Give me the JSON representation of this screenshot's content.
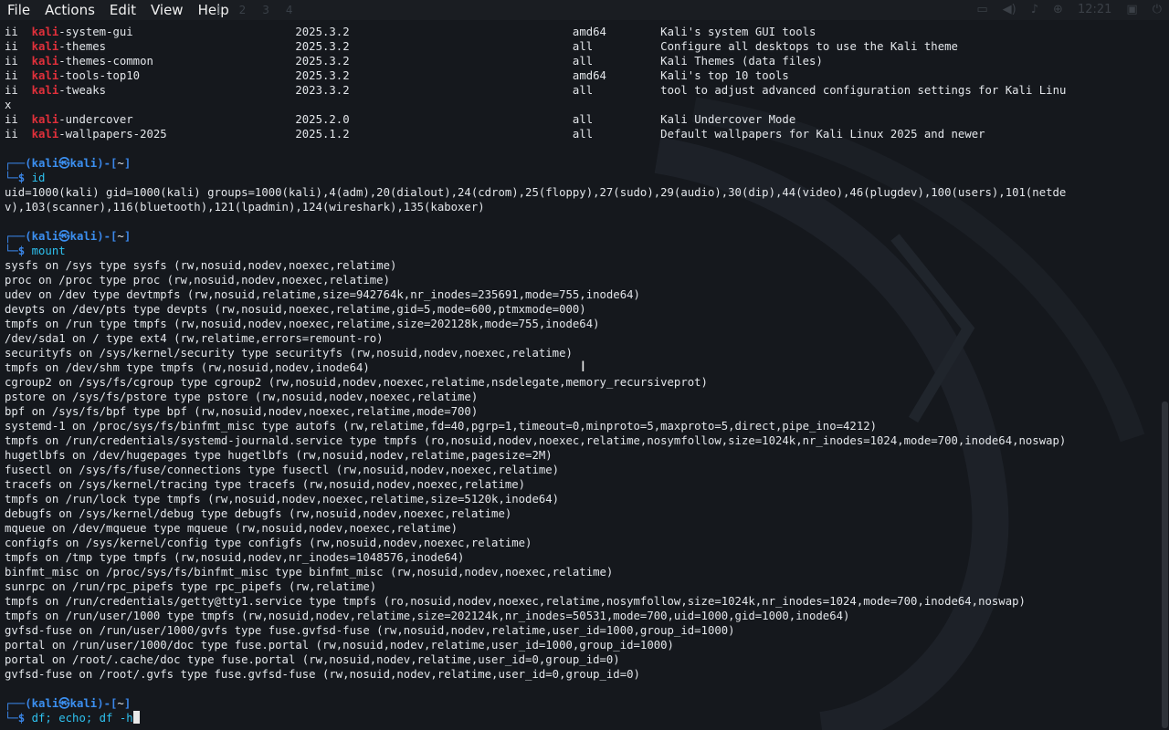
{
  "menu": [
    "File",
    "Actions",
    "Edit",
    "View",
    "Help"
  ],
  "tray": {
    "clock": "12:21"
  },
  "workspaces": [
    "1",
    "2",
    "3",
    "4"
  ],
  "packages": [
    {
      "prefix": "ii",
      "name_hl": "kali",
      "name_rest": "-system-gui",
      "version": "2025.3.2",
      "arch": "amd64",
      "desc": "Kali's system GUI tools"
    },
    {
      "prefix": "ii",
      "name_hl": "kali",
      "name_rest": "-themes",
      "version": "2025.3.2",
      "arch": "all",
      "desc": "Configure all desktops to use the Kali theme"
    },
    {
      "prefix": "ii",
      "name_hl": "kali",
      "name_rest": "-themes-common",
      "version": "2025.3.2",
      "arch": "all",
      "desc": "Kali Themes (data files)"
    },
    {
      "prefix": "ii",
      "name_hl": "kali",
      "name_rest": "-tools-top10",
      "version": "2025.3.2",
      "arch": "amd64",
      "desc": "Kali's top 10 tools"
    },
    {
      "prefix": "ii",
      "name_hl": "kali",
      "name_rest": "-tweaks",
      "version": "2023.3.2",
      "arch": "all",
      "desc": "tool to adjust advanced configuration settings for Kali Linu"
    },
    {
      "prefix": "ii",
      "name_hl": "kali",
      "name_rest": "-undercover",
      "version": "2025.2.0",
      "arch": "all",
      "desc": "Kali Undercover Mode"
    },
    {
      "prefix": "ii",
      "name_hl": "kali",
      "name_rest": "-wallpapers-2025",
      "version": "2025.1.2",
      "arch": "all",
      "desc": "Default wallpapers for Kali Linux 2025 and newer"
    }
  ],
  "wrap_x": "x",
  "prompt": {
    "user": "kali",
    "host": "kali",
    "dir": "~"
  },
  "id_cmd": "id",
  "id_output": [
    "uid=1000(kali) gid=1000(kali) groups=1000(kali),4(adm),20(dialout),24(cdrom),25(floppy),27(sudo),29(audio),30(dip),44(video),46(plugdev),100(users),101(netde",
    "v),103(scanner),116(bluetooth),121(lpadmin),124(wireshark),135(kaboxer)"
  ],
  "mount_cmd": "mount",
  "mount_output": [
    "sysfs on /sys type sysfs (rw,nosuid,nodev,noexec,relatime)",
    "proc on /proc type proc (rw,nosuid,nodev,noexec,relatime)",
    "udev on /dev type devtmpfs (rw,nosuid,relatime,size=942764k,nr_inodes=235691,mode=755,inode64)",
    "devpts on /dev/pts type devpts (rw,nosuid,noexec,relatime,gid=5,mode=600,ptmxmode=000)",
    "tmpfs on /run type tmpfs (rw,nosuid,nodev,noexec,relatime,size=202128k,mode=755,inode64)",
    "/dev/sda1 on / type ext4 (rw,relatime,errors=remount-ro)",
    "securityfs on /sys/kernel/security type securityfs (rw,nosuid,nodev,noexec,relatime)",
    "tmpfs on /dev/shm type tmpfs (rw,nosuid,nodev,inode64)",
    "cgroup2 on /sys/fs/cgroup type cgroup2 (rw,nosuid,nodev,noexec,relatime,nsdelegate,memory_recursiveprot)",
    "pstore on /sys/fs/pstore type pstore (rw,nosuid,nodev,noexec,relatime)",
    "bpf on /sys/fs/bpf type bpf (rw,nosuid,nodev,noexec,relatime,mode=700)",
    "systemd-1 on /proc/sys/fs/binfmt_misc type autofs (rw,relatime,fd=40,pgrp=1,timeout=0,minproto=5,maxproto=5,direct,pipe_ino=4212)",
    "tmpfs on /run/credentials/systemd-journald.service type tmpfs (ro,nosuid,nodev,noexec,relatime,nosymfollow,size=1024k,nr_inodes=1024,mode=700,inode64,noswap)",
    "hugetlbfs on /dev/hugepages type hugetlbfs (rw,nosuid,nodev,relatime,pagesize=2M)",
    "fusectl on /sys/fs/fuse/connections type fusectl (rw,nosuid,nodev,noexec,relatime)",
    "tracefs on /sys/kernel/tracing type tracefs (rw,nosuid,nodev,noexec,relatime)",
    "tmpfs on /run/lock type tmpfs (rw,nosuid,nodev,noexec,relatime,size=5120k,inode64)",
    "debugfs on /sys/kernel/debug type debugfs (rw,nosuid,nodev,noexec,relatime)",
    "mqueue on /dev/mqueue type mqueue (rw,nosuid,nodev,noexec,relatime)",
    "configfs on /sys/kernel/config type configfs (rw,nosuid,nodev,noexec,relatime)",
    "tmpfs on /tmp type tmpfs (rw,nosuid,nodev,nr_inodes=1048576,inode64)",
    "binfmt_misc on /proc/sys/fs/binfmt_misc type binfmt_misc (rw,nosuid,nodev,noexec,relatime)",
    "sunrpc on /run/rpc_pipefs type rpc_pipefs (rw,relatime)",
    "tmpfs on /run/credentials/getty@tty1.service type tmpfs (ro,nosuid,nodev,noexec,relatime,nosymfollow,size=1024k,nr_inodes=1024,mode=700,inode64,noswap)",
    "tmpfs on /run/user/1000 type tmpfs (rw,nosuid,nodev,relatime,size=202124k,nr_inodes=50531,mode=700,uid=1000,gid=1000,inode64)",
    "gvfsd-fuse on /run/user/1000/gvfs type fuse.gvfsd-fuse (rw,nosuid,nodev,relatime,user_id=1000,group_id=1000)",
    "portal on /run/user/1000/doc type fuse.portal (rw,nosuid,nodev,relatime,user_id=1000,group_id=1000)",
    "portal on /root/.cache/doc type fuse.portal (rw,nosuid,nodev,relatime,user_id=0,group_id=0)",
    "gvfsd-fuse on /root/.gvfs type fuse.gvfsd-fuse (rw,nosuid,nodev,relatime,user_id=0,group_id=0)"
  ],
  "current_cmd": "df; echo; df -h",
  "colors": {
    "bg": "#15181d",
    "accent_blue": "#3b8ff0",
    "accent_red": "#e0303b",
    "cmd_cyan": "#2ec2f0"
  }
}
